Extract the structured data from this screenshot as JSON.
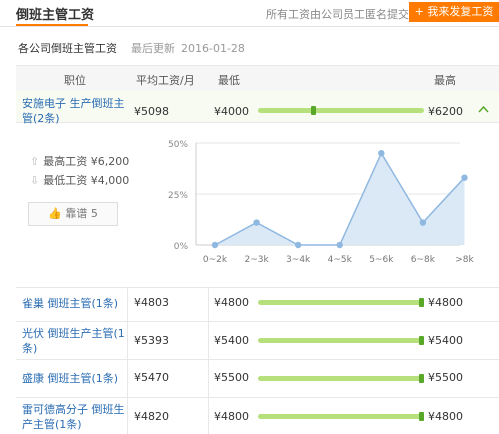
{
  "header": {
    "title": "倒班主管工资",
    "note": "所有工资由公司员工匿名提交",
    "button_label": "+ 我来发复工资"
  },
  "subheader": {
    "scope": "各公司倒班主管工资",
    "updated_label": "最后更新",
    "updated_date": "2016-01-28"
  },
  "table": {
    "headers": {
      "job": "职位",
      "avg": "平均工资/月",
      "min": "最低",
      "max": "最高"
    },
    "rows": [
      {
        "job": "安施电子 生产倒班主管(2条)",
        "avg": "¥5098",
        "min": "¥4000",
        "max": "¥6200",
        "bar_level": 0.35,
        "expanded": true
      },
      {
        "job": "雀巢 倒班主管(1条)",
        "avg": "¥4803",
        "min": "¥4800",
        "max": "¥4800",
        "bar_level": 1.0
      },
      {
        "job": "光伏 倒班生产主管(1条)",
        "avg": "¥5393",
        "min": "¥5400",
        "max": "¥5400",
        "bar_level": 1.0
      },
      {
        "job": "盛康 倒班主管(1条)",
        "avg": "¥5470",
        "min": "¥5500",
        "max": "¥5500",
        "bar_level": 1.0
      },
      {
        "job": "雷可德高分子 倒班生产主管(1条)",
        "avg": "¥4820",
        "min": "¥4800",
        "max": "¥4800",
        "bar_level": 1.0
      }
    ]
  },
  "detail": {
    "max_label": "最高工资",
    "max_value": "¥6,200",
    "min_label": "最低工资",
    "min_value": "¥4,000",
    "like_label": "靠谱 5"
  },
  "icons": {
    "up": "arrow-up-icon",
    "down": "arrow-down-icon",
    "like": "thumbs-up-icon",
    "chevron": "chevron-up-icon"
  },
  "colors": {
    "accent": "#ff7a00",
    "link": "#2a6cb3",
    "bar": "#b5e07b",
    "marker": "#5aa82a",
    "chart_line": "#8fb8e0",
    "chart_fill": "#dbe9f7"
  },
  "chart_data": {
    "type": "area",
    "categories": [
      "0~2k",
      "2~3k",
      "3~4k",
      "4~5k",
      "5~6k",
      "6~8k",
      ">8k"
    ],
    "values": [
      0,
      11,
      0,
      0,
      45,
      11,
      33
    ],
    "ylim": [
      0,
      50
    ],
    "yticks": [
      "0%",
      "25%",
      "50%"
    ],
    "grid": true
  }
}
